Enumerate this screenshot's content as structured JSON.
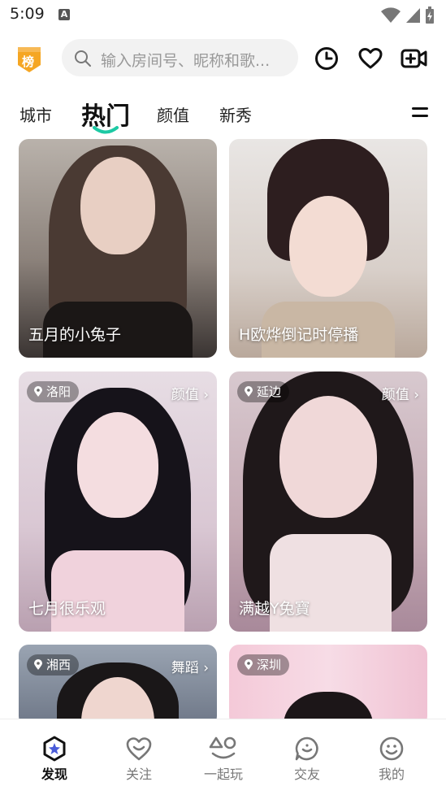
{
  "status": {
    "time": "5:09",
    "a_icon": "A"
  },
  "header": {
    "rank_badge": "榜",
    "search_placeholder": "输入房间号、昵称和歌...",
    "icons": [
      "history-icon",
      "heart-icon",
      "video-add-icon"
    ]
  },
  "tabs": [
    {
      "label": "城市",
      "active": false
    },
    {
      "label": "热门",
      "active": true
    },
    {
      "label": "颜值",
      "active": false
    },
    {
      "label": "新秀",
      "active": false
    }
  ],
  "cards": [
    {
      "name": "五月的小兔子",
      "location": "",
      "category": ""
    },
    {
      "name": "H欧烨倒记时停播",
      "location": "",
      "category": ""
    },
    {
      "name": "七月很乐观",
      "location": "洛阳",
      "category": "颜值 ›"
    },
    {
      "name": "满越Y兔寶",
      "location": "延边",
      "category": "颜值 ›"
    },
    {
      "name": "",
      "location": "湘西",
      "category": "舞蹈 ›"
    },
    {
      "name": "",
      "location": "深圳",
      "category": ""
    }
  ],
  "bottom_nav": [
    {
      "label": "发现",
      "active": true
    },
    {
      "label": "关注",
      "active": false
    },
    {
      "label": "一起玩",
      "active": false
    },
    {
      "label": "交友",
      "active": false
    },
    {
      "label": "我的",
      "active": false
    }
  ],
  "colors": {
    "accent": "#1dc9a4",
    "badge": "#f5a623"
  }
}
